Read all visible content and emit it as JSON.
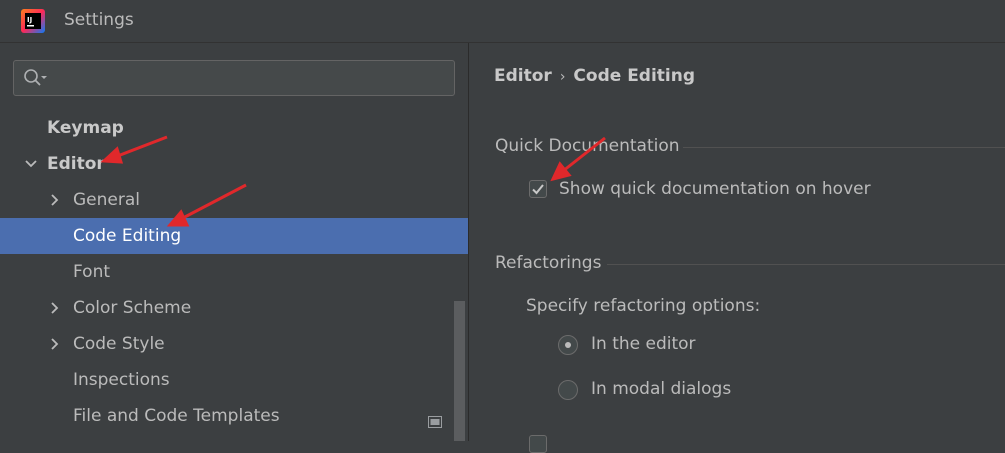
{
  "window": {
    "title": "Settings",
    "app_icon": "intellij-logo-icon"
  },
  "sidebar": {
    "search": {
      "value": "",
      "placeholder": "",
      "icon": "search-icon"
    },
    "items": [
      {
        "label": "Keymap",
        "bold": true
      },
      {
        "label": "Editor",
        "bold": true,
        "expanded": true
      },
      {
        "label": "General",
        "collapsed": true
      },
      {
        "label": "Code Editing",
        "selected": true
      },
      {
        "label": "Font"
      },
      {
        "label": "Color Scheme",
        "collapsed": true
      },
      {
        "label": "Code Style",
        "collapsed": true
      },
      {
        "label": "Inspections",
        "icon": "panel-icon"
      },
      {
        "label": "File and Code Templates"
      }
    ]
  },
  "content": {
    "breadcrumb": {
      "parent": "Editor",
      "separator": "›",
      "current": "Code Editing"
    },
    "quick_doc": {
      "title": "Quick Documentation",
      "checkbox_label": "Show quick documentation on hover",
      "checked": true
    },
    "refactorings": {
      "title": "Refactorings",
      "options_label": "Specify refactoring options:",
      "radios": [
        {
          "label": "In the editor",
          "selected": true
        },
        {
          "label": "In modal dialogs",
          "selected": false
        }
      ]
    }
  },
  "colors": {
    "background": "#3c3f41",
    "selection": "#4b6eaf",
    "annotation_arrow": "#e0282b"
  }
}
